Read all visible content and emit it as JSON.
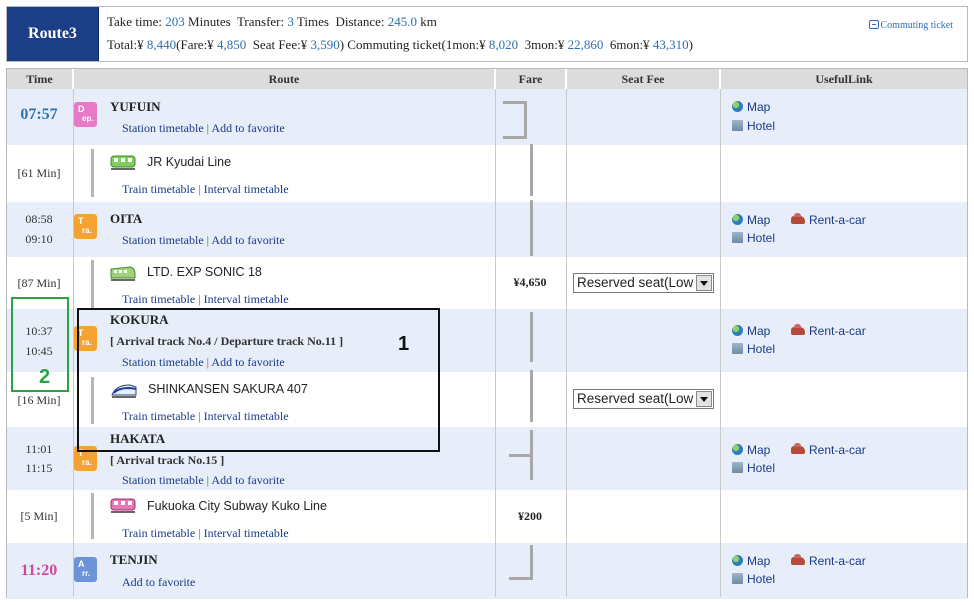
{
  "header": {
    "route_label": "Route3",
    "take_time_label": "Take time:",
    "take_time_value": "203",
    "minutes_label": "Minutes",
    "transfer_label": "Transfer:",
    "transfer_value": "3",
    "times_label": "Times",
    "distance_label": "Distance:",
    "distance_value": "245.0",
    "km_label": "km",
    "total_label": "Total:¥",
    "total_value": "8,440",
    "fare_label": "(Fare:¥",
    "fare_value": "4,850",
    "seatfee_label": "Seat Fee:¥",
    "seatfee_value": "3,590",
    "commuting_label": ")  Commuting ticket(1mon:¥",
    "mon1_value": "8,020",
    "mon3_label": "3mon:¥",
    "mon3_value": "22,860",
    "mon6_label": "6mon:¥",
    "mon6_value": "43,310",
    "close_paren": ")",
    "commuting_link": "Commuting ticket"
  },
  "columns": {
    "time": "Time",
    "route": "Route",
    "fare": "Fare",
    "seat_fee": "Seat Fee",
    "useful_link": "UsefulLink"
  },
  "links": {
    "station_timetable": "Station timetable",
    "add_to_favorite": "Add to favorite",
    "train_timetable": "Train timetable",
    "interval_timetable": "Interval timetable",
    "separator": "|",
    "map": "Map",
    "hotel": "Hotel",
    "rent_a_car": "Rent-a-car"
  },
  "badges": {
    "dep": [
      "D",
      "ep."
    ],
    "tra": [
      "T",
      "ra."
    ],
    "arr": [
      "A",
      "rr."
    ]
  },
  "stations": {
    "yufuin": {
      "name": "YUFUIN",
      "time": "07:57"
    },
    "oita": {
      "name": "OITA",
      "arr": "08:58",
      "dep": "09:10"
    },
    "kokura": {
      "name": "KOKURA",
      "arr": "10:37",
      "dep": "10:45",
      "track": "[ Arrival track No.4 / Departure track No.11 ]"
    },
    "hakata": {
      "name": "HAKATA",
      "arr": "11:01",
      "dep": "11:15",
      "track": "[ Arrival track No.15 ]"
    },
    "tenjin": {
      "name": "TENJIN",
      "time": "11:20"
    }
  },
  "segments": {
    "s1": {
      "duration": "[61 Min]",
      "line": "JR Kyudai Line"
    },
    "s2": {
      "duration": "[87 Min]",
      "line": "LTD. EXP SONIC 18",
      "fare": "¥4,650",
      "seat": "Reserved seat(Low"
    },
    "s3": {
      "duration": "[16 Min]",
      "line": "SHINKANSEN SAKURA 407",
      "seat": "Reserved seat(Low"
    },
    "s4": {
      "duration": "[5 Min]",
      "line": "Fukuoka City Subway Kuko Line",
      "fare": "¥200"
    }
  },
  "annotations": {
    "a1": "1",
    "a2": "2"
  },
  "colors": {
    "route_badge": "#1b3e86",
    "station_row": "#e7eef9",
    "dep_badge": "#e779c6",
    "tra_badge": "#f5a231",
    "arr_badge": "#6a93d8",
    "annot1": "#111111",
    "annot2": "#2aa345"
  }
}
